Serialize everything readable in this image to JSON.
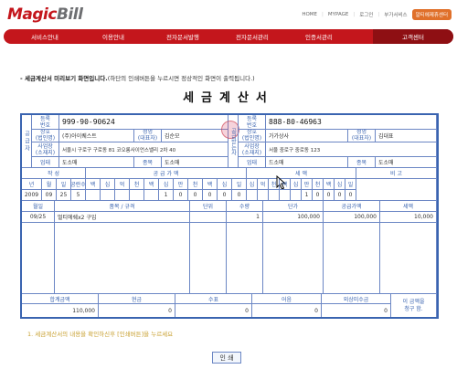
{
  "header": {
    "logo_magic": "Magic",
    "logo_bill": "Bill",
    "links": [
      "HOME",
      "MYPAGE",
      "로그인",
      "부가서비스"
    ],
    "highlight_button": "알티에제휴센터"
  },
  "nav": {
    "items": [
      "서비스안내",
      "이용안내",
      "전자문서발행",
      "전자문서관리",
      "인증서관리"
    ],
    "active": "고객센터"
  },
  "notice": {
    "bold": "- 세금계산서 미리보기 화면입니다.",
    "rest": "(하단의 인쇄버튼을 누르시면 정상적인 화면이 출력됩니다.)"
  },
  "doc_title": "세금계산서",
  "supplier": {
    "side_label": "공급자",
    "reg_label_1": "등록",
    "reg_label_2": "번호",
    "reg_no": "999-90-90624",
    "name_label_1": "상호",
    "name_label_2": "(법인명)",
    "name": "(주)아이퀘스트",
    "rep_label_1": "성명",
    "rep_label_2": "(대표자)",
    "rep": "김순모",
    "addr_label_1": "사업장",
    "addr_label_2": "(소재지)",
    "address": "서울시 구로구 구로동 81 코오롱사이언스밸리 2차 40",
    "type_label": "업태",
    "type": "도소매",
    "item_label": "종목",
    "item": "도소매"
  },
  "receiver": {
    "side_label": "공급받는자",
    "reg_label_1": "등록",
    "reg_label_2": "번호",
    "reg_no": "888-80-46963",
    "name_label_1": "상호",
    "name_label_2": "(법인명)",
    "name": "가가상사",
    "rep_label_1": "성명",
    "rep_label_2": "(대표자)",
    "rep": "김대표",
    "addr_label_1": "사업장",
    "addr_label_2": "(소재지)",
    "address": "서울 중로구 중로동 123",
    "type_label": "업태",
    "type": "드소매",
    "item_label": "종목",
    "item": "도소매"
  },
  "amounts": {
    "write_label": "작 성",
    "supply_label": "공 급 가 액",
    "tax_label": "세 액",
    "note_label": "비 고",
    "date_headers": [
      "년",
      "월",
      "일",
      "공란수"
    ],
    "digit_headers_supply": [
      "백",
      "십",
      "억",
      "천",
      "백",
      "십",
      "만",
      "천",
      "백",
      "십",
      "일"
    ],
    "digit_headers_tax": [
      "십",
      "억",
      "천",
      "백",
      "십",
      "만",
      "천",
      "백",
      "십",
      "일"
    ],
    "year": "2009",
    "month": "09",
    "day": "25",
    "blanks": "5",
    "supply_value": "100000",
    "tax_value": "10000"
  },
  "items_table": {
    "headers": [
      "월일",
      "품목 / 규격",
      "단위",
      "수량",
      "단가",
      "공급가액",
      "세액"
    ],
    "rows": [
      {
        "date": "09/25",
        "item": "멀티에쉐x2 구입",
        "unit": "",
        "qty": "1",
        "price": "100,000",
        "supply": "100,000",
        "tax": "10,000"
      }
    ]
  },
  "totals": {
    "headers": [
      "합계금액",
      "현금",
      "수표",
      "어음",
      "외상미수금"
    ],
    "values": [
      "110,000",
      "0",
      "0",
      "0",
      "0"
    ],
    "claim_1": "이 금액을",
    "claim_2": "청구 함."
  },
  "confirm_text": "1. 세금계산서의 내용을 확인하신후 [인쇄버튼]을 누르세요",
  "print_button": "인 쇄",
  "colors": {
    "brand": "#c4161c",
    "grid": "#6b86c4",
    "frame": "#3a64b0"
  }
}
